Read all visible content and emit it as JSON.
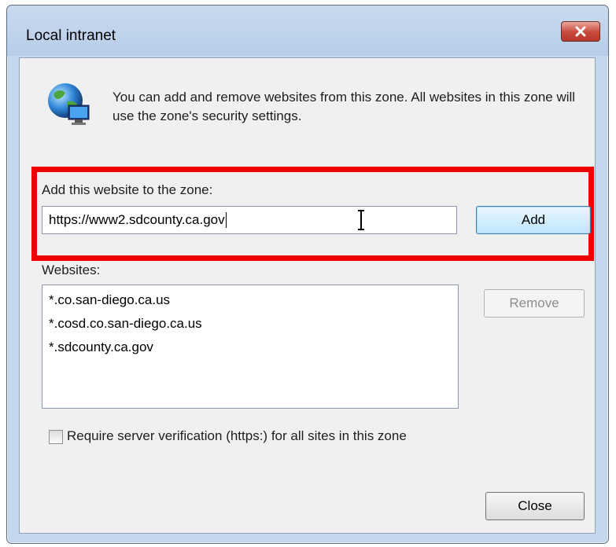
{
  "window": {
    "title": "Local intranet"
  },
  "intro": {
    "text": "You can add and remove websites from this zone. All websites in this zone will use the zone's security settings."
  },
  "add_section": {
    "label": "Add this website to the zone:",
    "url_value": "https://www2.sdcounty.ca.gov",
    "add_label": "Add"
  },
  "websites": {
    "label": "Websites:",
    "items": [
      "*.co.san-diego.ca.us",
      "*.cosd.co.san-diego.ca.us",
      "*.sdcounty.ca.gov"
    ],
    "remove_label": "Remove"
  },
  "verification": {
    "label": "Require server verification (https:) for all sites in this zone",
    "checked": false
  },
  "footer": {
    "close_label": "Close"
  },
  "colors": {
    "highlight": "#ee0000",
    "title_close": "#c8483a",
    "frame": "#c5d7ec"
  },
  "icons": {
    "zone": "globe-computer-icon",
    "close": "close-icon",
    "cursor": "text-cursor-icon"
  }
}
